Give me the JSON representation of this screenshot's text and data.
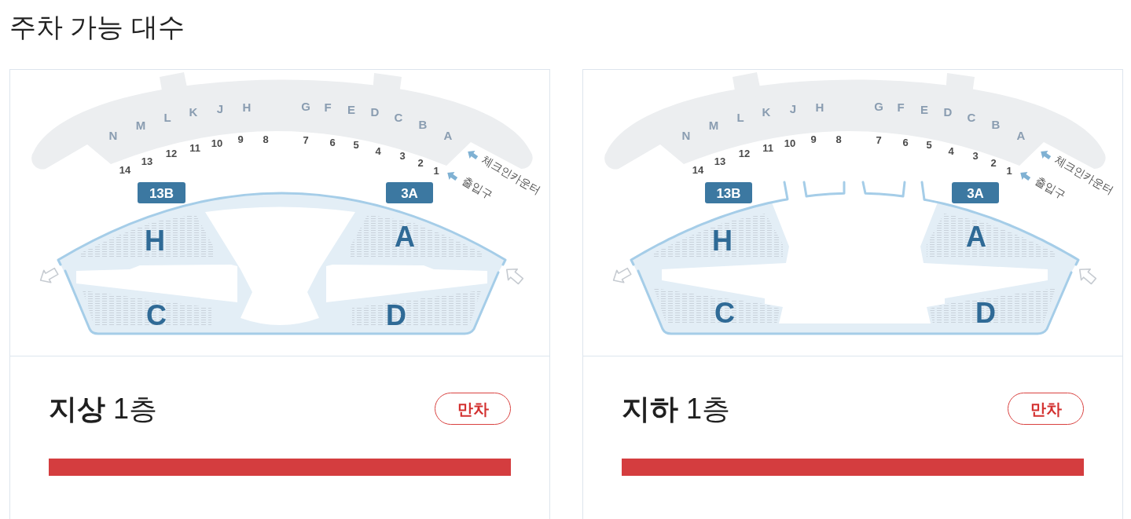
{
  "title": "주차 가능 대수",
  "floors": [
    {
      "map": {
        "kind": "ground",
        "counters": [
          "N",
          "M",
          "L",
          "K",
          "J",
          "H",
          "G",
          "F",
          "E",
          "D",
          "C",
          "B",
          "A"
        ],
        "doors": [
          "14",
          "13",
          "12",
          "11",
          "10",
          "9",
          "8",
          "7",
          "6",
          "5",
          "4",
          "3",
          "2",
          "1"
        ],
        "gates": [
          "13B",
          "3A"
        ],
        "zones": [
          "H",
          "A",
          "C",
          "D"
        ],
        "legend": [
          "체크인카운터",
          "출입구"
        ]
      },
      "name": "**지상** 1층",
      "status": "만차",
      "level": 1
    },
    {
      "map": {
        "kind": "basement",
        "counters": [
          "N",
          "M",
          "L",
          "K",
          "J",
          "H",
          "G",
          "F",
          "E",
          "D",
          "C",
          "B",
          "A"
        ],
        "doors": [
          "14",
          "13",
          "12",
          "11",
          "10",
          "9",
          "8",
          "7",
          "6",
          "5",
          "4",
          "3",
          "2",
          "1"
        ],
        "gates": [
          "13B",
          "3A"
        ],
        "zones": [
          "H",
          "A",
          "C",
          "D"
        ],
        "legend": [
          "체크인카운터",
          "출입구"
        ]
      },
      "name": "**지하** 1층",
      "status": "만차",
      "level": 1
    }
  ]
}
